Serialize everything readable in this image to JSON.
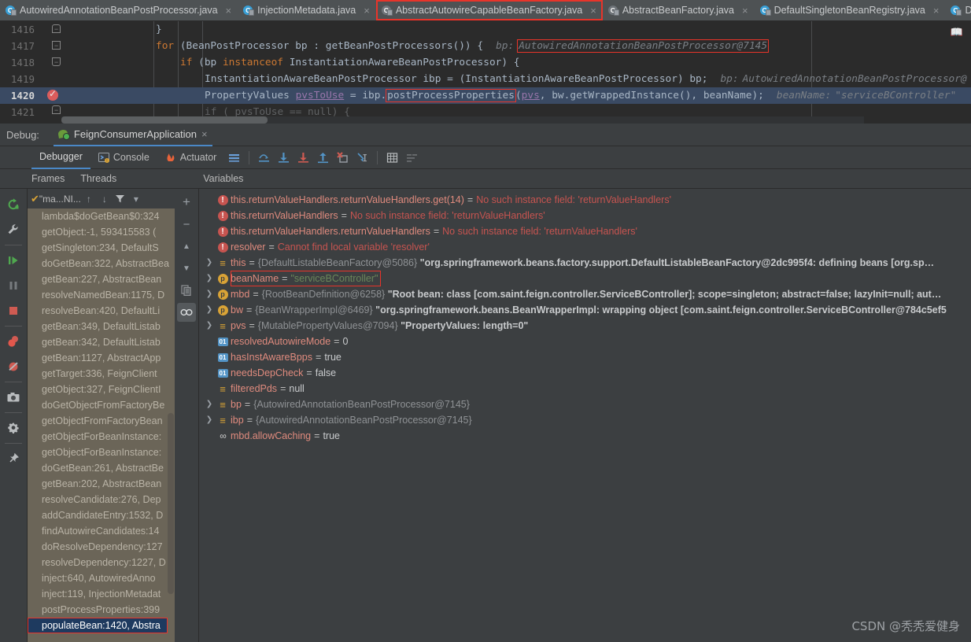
{
  "tabs": [
    {
      "label": "AutowiredAnnotationBeanPostProcessor.java",
      "icon": "java-class-icon",
      "active": false,
      "selected": false
    },
    {
      "label": "InjectionMetadata.java",
      "icon": "java-class-icon",
      "active": false,
      "selected": false
    },
    {
      "label": "AbstractAutowireCapableBeanFactory.java",
      "icon": "java-class-icon",
      "active": true,
      "selected": true
    },
    {
      "label": "AbstractBeanFactory.java",
      "icon": "java-class-icon",
      "active": false,
      "selected": false
    },
    {
      "label": "DefaultSingletonBeanRegistry.java",
      "icon": "java-class-icon",
      "active": false,
      "selected": false
    },
    {
      "label": "DependencyDe",
      "icon": "java-class-icon",
      "active": false,
      "selected": false
    }
  ],
  "tab_close_glyph": "×",
  "editor": {
    "lines": [
      {
        "num": "1416",
        "current": false,
        "breakpoint": false
      },
      {
        "num": "1417",
        "current": false,
        "breakpoint": false
      },
      {
        "num": "1418",
        "current": false,
        "breakpoint": false
      },
      {
        "num": "1419",
        "current": false,
        "breakpoint": false
      },
      {
        "num": "1420",
        "current": true,
        "breakpoint": true
      },
      {
        "num": "1421",
        "current": false,
        "breakpoint": false
      }
    ],
    "code": {
      "l1416": "}",
      "l1417_kw": "for",
      "l1417_rest": " (BeanPostProcessor bp : getBeanPostProcessors()) {",
      "l1417_hint_label": "bp:",
      "l1417_hint_value": "AutowiredAnnotationBeanPostProcessor@7145",
      "l1418_kw": "if",
      "l1418_a": " (bp ",
      "l1418_kw2": "instanceof",
      "l1418_b": " InstantiationAwareBeanPostProcessor) {",
      "l1419_a": "InstantiationAwareBeanPostProcessor ibp = (InstantiationAwareBeanPostProcessor) bp;",
      "l1419_hint_label": "bp:",
      "l1419_hint_value": "AutowiredAnnotationBeanPostProcessor@",
      "l1420_a": "PropertyValues ",
      "l1420_field": "pvsToUse",
      "l1420_b": " = ibp.",
      "l1420_method": "postProcessProperties",
      "l1420_c": "(",
      "l1420_arg1": "pvs",
      "l1420_d": ", bw.getWrappedInstance(), beanName);",
      "l1420_hint_label": "beanName:",
      "l1420_hint_value": "\"serviceBController\"",
      "l1421_a": "if ( pvsToUse == null) {"
    },
    "book_icon": "reader-mode-icon"
  },
  "debug_header": {
    "label": "Debug:",
    "run_config": "FeignConsumerApplication",
    "close_glyph": "×"
  },
  "tool_tabs": [
    {
      "label": "Debugger",
      "icon": "debugger-icon",
      "active": true
    },
    {
      "label": "Console",
      "icon": "console-icon",
      "active": false
    },
    {
      "label": "Actuator",
      "icon": "actuator-icon",
      "active": false
    }
  ],
  "debug_toolbar_icons": [
    "layout-settings-icon",
    "step-over-icon",
    "step-into-icon",
    "force-step-into-icon",
    "step-out-icon",
    "drop-frame-icon",
    "run-to-cursor-icon",
    "evaluate-expression-icon",
    "mute-breakpoints-icon"
  ],
  "left_rail_icons": [
    "rerun-icon",
    "settings-wrench-icon",
    "resume-program-icon",
    "pause-program-icon",
    "stop-icon",
    "view-breakpoints-icon",
    "mute-breakpoints-icon",
    "camera-snapshot-icon",
    "debug-settings-gear-icon",
    "pin-tab-icon"
  ],
  "panels": {
    "frames_title": "Frames",
    "threads_title": "Threads",
    "variables_title": "Variables"
  },
  "frames_toolbar": {
    "thread_label": "\"ma...NI...",
    "check_glyph": "✔",
    "up_icon": "arrow-up-icon",
    "down_icon": "arrow-down-icon",
    "filter_icon": "filter-icon",
    "dropdown_icon": "chevron-down-icon"
  },
  "frames_rail": {
    "add_icon": "+",
    "remove_icon": "−",
    "up_icon": "▲",
    "down_icon": "▼",
    "copy_icon": "copy-icon",
    "watches_icon": "watches-icon"
  },
  "frames": [
    {
      "text": "lambda$doGetBean$0:324",
      "selected": false
    },
    {
      "text": "getObject:-1, 593415583 (",
      "selected": false
    },
    {
      "text": "getSingleton:234, DefaultS",
      "selected": false
    },
    {
      "text": "doGetBean:322, AbstractBea",
      "selected": false
    },
    {
      "text": "getBean:227, AbstractBean",
      "selected": false
    },
    {
      "text": "resolveNamedBean:1175, D",
      "selected": false
    },
    {
      "text": "resolveBean:420, DefaultLi",
      "selected": false
    },
    {
      "text": "getBean:349, DefaultListab",
      "selected": false
    },
    {
      "text": "getBean:342, DefaultListab",
      "selected": false
    },
    {
      "text": "getBean:1127, AbstractApp",
      "selected": false
    },
    {
      "text": "getTarget:336, FeignClient",
      "selected": false
    },
    {
      "text": "getObject:327, FeignClientI",
      "selected": false
    },
    {
      "text": "doGetObjectFromFactoryBe",
      "selected": false
    },
    {
      "text": "getObjectFromFactoryBean",
      "selected": false
    },
    {
      "text": "getObjectForBeanInstance:",
      "selected": false
    },
    {
      "text": "getObjectForBeanInstance:",
      "selected": false
    },
    {
      "text": "doGetBean:261, AbstractBe",
      "selected": false
    },
    {
      "text": "getBean:202, AbstractBean",
      "selected": false
    },
    {
      "text": "resolveCandidate:276, Dep",
      "selected": false
    },
    {
      "text": "addCandidateEntry:1532, D",
      "selected": false
    },
    {
      "text": "findAutowireCandidates:14",
      "selected": false
    },
    {
      "text": "doResolveDependency:127",
      "selected": false
    },
    {
      "text": "resolveDependency:1227, D",
      "selected": false
    },
    {
      "text": "inject:640, AutowiredAnno",
      "selected": false
    },
    {
      "text": "inject:119, InjectionMetadat",
      "selected": false
    },
    {
      "text": "postProcessProperties:399",
      "selected": false
    },
    {
      "text": "populateBean:1420, Abstra",
      "selected": true
    }
  ],
  "variables": [
    {
      "icon": "error-icon",
      "arrow": false,
      "name": "this.returnValueHandlers.returnValueHandlers.get(14)",
      "eq": "=",
      "value": "No such instance field: 'returnValueHandlers'",
      "value_kind": "error"
    },
    {
      "icon": "error-icon",
      "arrow": false,
      "name": "this.returnValueHandlers",
      "eq": "=",
      "value": "No such instance field: 'returnValueHandlers'",
      "value_kind": "error"
    },
    {
      "icon": "error-icon",
      "arrow": false,
      "name": "this.returnValueHandlers.returnValueHandlers",
      "eq": "=",
      "value": "No such instance field: 'returnValueHandlers'",
      "value_kind": "error"
    },
    {
      "icon": "error-icon",
      "arrow": false,
      "name": "resolver",
      "eq": "=",
      "value": "Cannot find local variable 'resolver'",
      "value_kind": "error"
    },
    {
      "icon": "object-icon",
      "arrow": true,
      "name": "this",
      "eq": "=",
      "type": "{DefaultListableBeanFactory@5086}",
      "value": "\"org.springframework.beans.factory.support.DefaultListableBeanFactory@2dc995f4: defining beans [org.sp…",
      "value_kind": "string"
    },
    {
      "icon": "param-icon",
      "arrow": true,
      "name": "beanName",
      "eq": "=",
      "value": "\"serviceBController\"",
      "value_kind": "green",
      "highlighted": true
    },
    {
      "icon": "param-icon",
      "arrow": true,
      "name": "mbd",
      "eq": "=",
      "type": "{RootBeanDefinition@6258}",
      "value": "\"Root bean: class [com.saint.feign.controller.ServiceBController]; scope=singleton; abstract=false; lazyInit=null; aut…",
      "value_kind": "string"
    },
    {
      "icon": "param-icon",
      "arrow": true,
      "name": "bw",
      "eq": "=",
      "type": "{BeanWrapperImpl@6469}",
      "value": "\"org.springframework.beans.BeanWrapperImpl: wrapping object [com.saint.feign.controller.ServiceBController@784c5ef5",
      "value_kind": "string"
    },
    {
      "icon": "object-icon",
      "arrow": true,
      "name": "pvs",
      "eq": "=",
      "type": "{MutablePropertyValues@7094}",
      "value": "\"PropertyValues: length=0\"",
      "value_kind": "string"
    },
    {
      "icon": "primitive-icon",
      "arrow": false,
      "name": "resolvedAutowireMode",
      "eq": "=",
      "value": "0",
      "value_kind": "num"
    },
    {
      "icon": "primitive-icon",
      "arrow": false,
      "name": "hasInstAwareBpps",
      "eq": "=",
      "value": "true",
      "value_kind": "num"
    },
    {
      "icon": "primitive-icon",
      "arrow": false,
      "name": "needsDepCheck",
      "eq": "=",
      "value": "false",
      "value_kind": "num"
    },
    {
      "icon": "object-icon",
      "arrow": false,
      "name": "filteredPds",
      "eq": "=",
      "value": "null",
      "value_kind": "num"
    },
    {
      "icon": "object-icon",
      "arrow": true,
      "name": "bp",
      "eq": "=",
      "type": "{AutowiredAnnotationBeanPostProcessor@7145}",
      "value": "",
      "value_kind": "string"
    },
    {
      "icon": "object-icon",
      "arrow": true,
      "name": "ibp",
      "eq": "=",
      "type": "{AutowiredAnnotationBeanPostProcessor@7145}",
      "value": "",
      "value_kind": "string"
    },
    {
      "icon": "watch-icon",
      "arrow": false,
      "name": "mbd.allowCaching",
      "eq": "=",
      "value": "true",
      "value_kind": "num"
    }
  ],
  "watermark": "CSDN @秃秃爱健身",
  "colors": {
    "accent_blue": "#4a88c7",
    "error_red": "#c75450",
    "highlight_box": "#e8342a",
    "frames_bg": "#6b6558",
    "selected_frame": "#1e3a5f",
    "editor_bg": "#2b2b2b",
    "panel_bg": "#3c3f41"
  }
}
